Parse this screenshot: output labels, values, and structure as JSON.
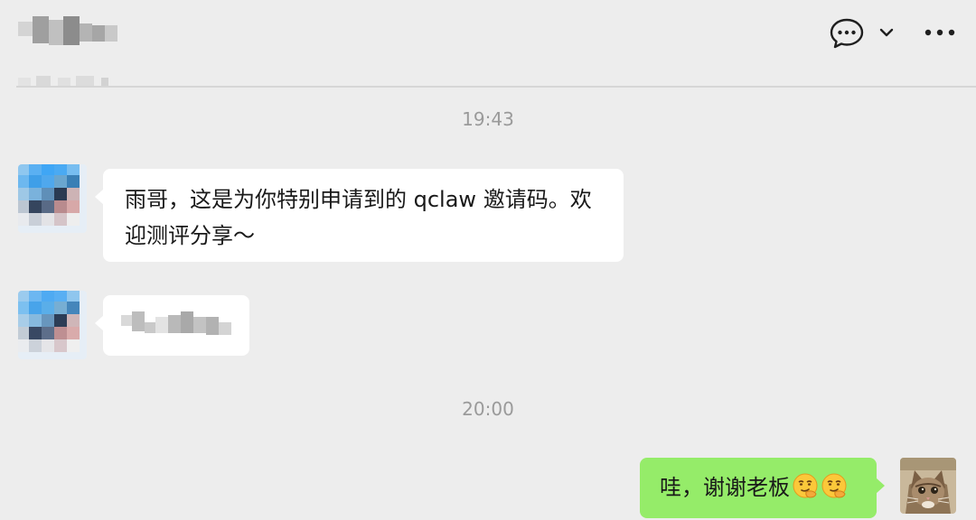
{
  "header": {
    "title": "",
    "icons": {
      "chat": "chat-bubble-icon",
      "dropdown": "chevron-down-icon",
      "more": "more-icon"
    }
  },
  "messages": {
    "time_1": "19:43",
    "msg_1_text": "雨哥，这是为你特别申请到的 qclaw 邀请码。欢迎测评分享～",
    "msg_1_line_1": "雨哥，这是为你特别申请到的 qclaw 邀请码。欢",
    "msg_1_line_2": "迎测评分享～",
    "msg_2_text": "",
    "time_2": "20:00",
    "msg_3_text": "哇，谢谢老板",
    "msg_3_emoji": "smirk-emoji"
  },
  "colors": {
    "background": "#ededed",
    "incoming_bubble": "#ffffff",
    "outgoing_bubble": "#95ec69",
    "timestamp": "#9a9a9a",
    "text": "#191919"
  }
}
